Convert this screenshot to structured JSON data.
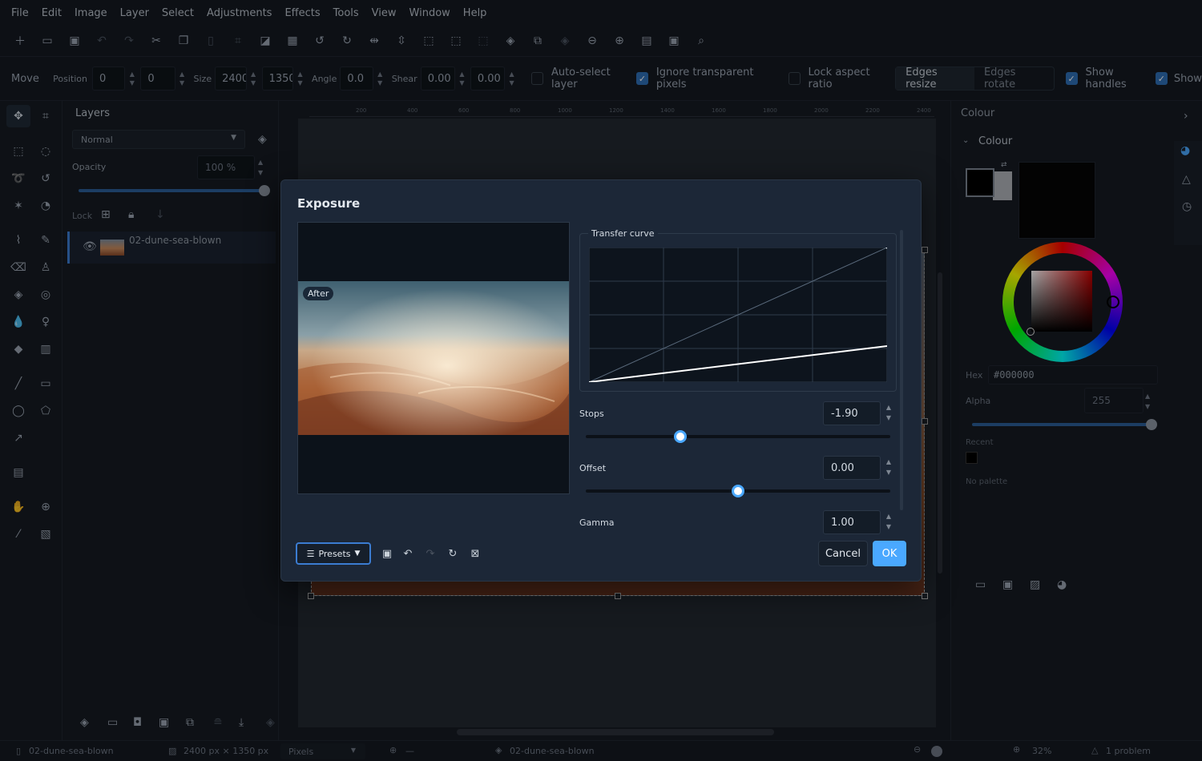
{
  "menu": [
    "File",
    "Edit",
    "Image",
    "Layer",
    "Select",
    "Adjustments",
    "Effects",
    "Tools",
    "View",
    "Window",
    "Help"
  ],
  "toolbar_icons": [
    "new-file-icon",
    "open-file-icon",
    "save-icon",
    "undo-icon",
    "redo-icon",
    "cut-icon",
    "copy-icon",
    "paste-icon",
    "crop-icon",
    "resize-image-icon",
    "resize-canvas-icon",
    "rotate-ccw-icon",
    "rotate-cw-icon",
    "flip-h-icon",
    "flip-v-icon",
    "select-all-icon",
    "deselect-icon",
    "invert-selection-icon",
    "layers-icon",
    "duplicate-icon",
    "merge-icon",
    "zoom-out-icon",
    "zoom-in-icon",
    "actual-size-icon",
    "fit-window-icon",
    "search-icon"
  ],
  "tool_options": {
    "tool_name": "Move",
    "position_label": "Position",
    "pos_x": "0",
    "pos_y": "0",
    "size_label": "Size",
    "size_w": "2400",
    "size_h": "1350",
    "angle_label": "Angle",
    "angle": "0.0",
    "shear_label": "Shear",
    "shear_x": "0.00",
    "shear_y": "0.00",
    "auto_select": "Auto-select layer",
    "ignore_transparent": "Ignore transparent pixels",
    "lock_aspect": "Lock aspect ratio",
    "edges_resize": "Edges resize",
    "edges_rotate": "Edges rotate",
    "show_handles": "Show handles",
    "show_more": "Show"
  },
  "layers": {
    "title": "Layers",
    "blend_mode": "Normal",
    "opacity_label": "Opacity",
    "opacity": "100 %",
    "opacity_value": 1.0,
    "lock_label": "Lock",
    "layer_name": "02-dune-sea-blown"
  },
  "ruler": [
    "200",
    "400",
    "600",
    "800",
    "1000",
    "1200",
    "1400",
    "1600",
    "1800",
    "2000",
    "2200",
    "2400"
  ],
  "right": {
    "panel_title": "Colour",
    "section_title": "Colour",
    "hex_label": "Hex",
    "hex": "#000000",
    "alpha_label": "Alpha",
    "alpha": "255",
    "recent_label": "Recent",
    "no_palette": "No palette"
  },
  "status": {
    "file": "02-dune-sea-blown",
    "dimensions": "2400 px × 1350 px",
    "units": "Pixels",
    "cursor": "—",
    "layer": "02-dune-sea-blown",
    "zoom": "32%",
    "problems": "1 problem"
  },
  "dialog": {
    "title": "Exposure",
    "after_badge": "After",
    "curve_title": "Transfer curve",
    "stops_label": "Stops",
    "stops_value": "-1.90",
    "stops_fraction": 0.31,
    "offset_label": "Offset",
    "offset_value": "0.00",
    "offset_fraction": 0.5,
    "gamma_label": "Gamma",
    "gamma_value": "1.00",
    "presets_label": "Presets",
    "cancel_label": "Cancel",
    "ok_label": "OK"
  },
  "colors": {
    "accent": "#4aa8ff",
    "check": "#2f6fb5",
    "background": "#161b22",
    "dialog": "#1c2737"
  }
}
